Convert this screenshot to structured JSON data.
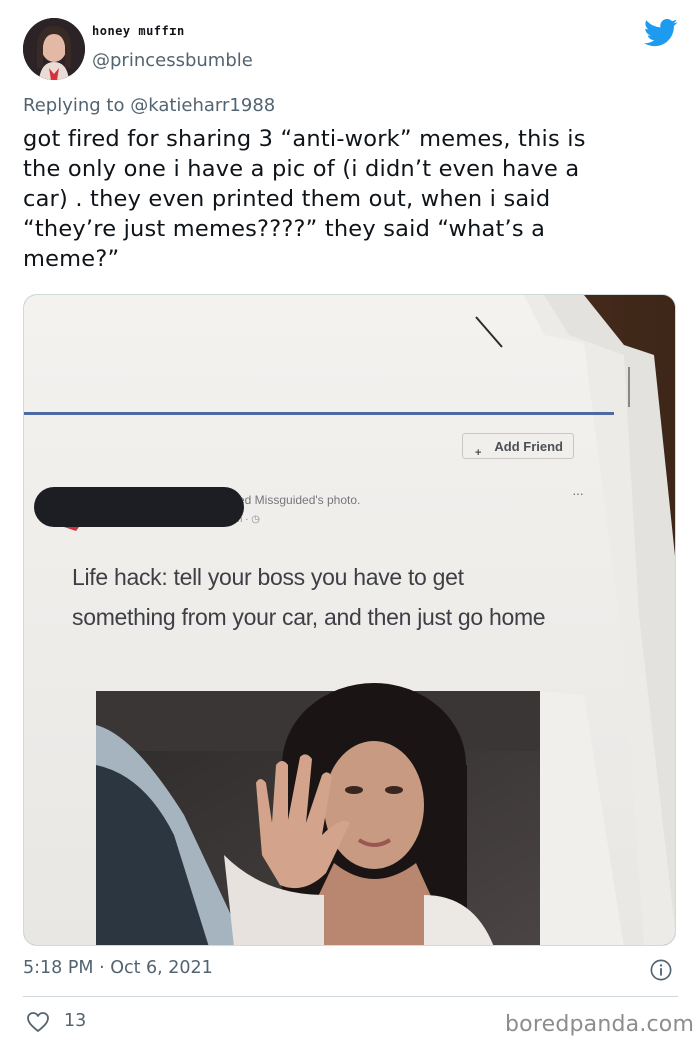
{
  "author": {
    "display_name": "honey muffɪn",
    "handle": "@princessbumble"
  },
  "reply": {
    "prefix": "Replying to",
    "target": "@katieharr1988"
  },
  "tweet_text": "got fired for sharing 3 “anti-work” memes, this is\nthe only one i have a pic of (i didn’t even have a\ncar) . they even printed them out, when i said\n“they’re just memes????” they said “what’s a\nmeme?”",
  "photo": {
    "add_friend_label": "Add Friend",
    "add_friend_icon": "+",
    "post_meta": "ed Missguided's photo.",
    "post_sub": "m · ◷",
    "more_icon": "···",
    "post_text": "Life hack: tell your boss you have to get something from your car, and then just go home"
  },
  "footer": {
    "timestamp": "5:18 PM · Oct 6, 2021",
    "likes": "13",
    "watermark": "boredpanda.com"
  },
  "icons": {
    "logo": "twitter-bird-icon",
    "info": "info-icon",
    "like": "heart-icon"
  },
  "colors": {
    "twitter_blue": "#1d9bf0",
    "secondary_text": "#536471",
    "primary_text": "#0f1419"
  }
}
